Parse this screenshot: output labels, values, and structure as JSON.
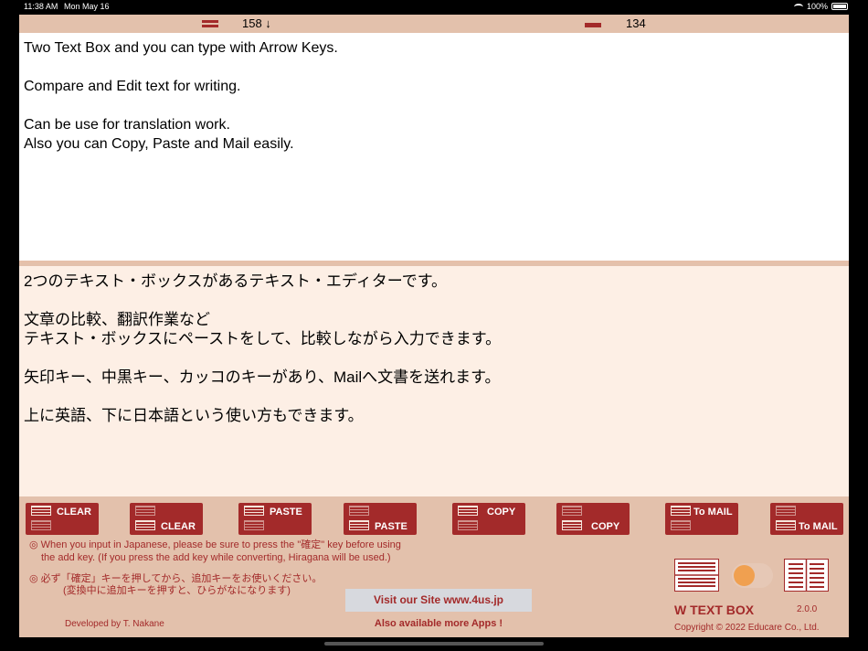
{
  "status": {
    "time": "11:38 AM",
    "date": "Mon May 16",
    "battery": "100%"
  },
  "counters": {
    "top": "158 ↓",
    "bottom": "134"
  },
  "box1_text": "Two Text Box and you can type with Arrow Keys.\n\nCompare and Edit text for writing.\n\nCan be use for translation work.\nAlso you can Copy, Paste and Mail easily.",
  "box2_text": "2つのテキスト・ボックスがあるテキスト・エディターです。\n\n文章の比較、翻訳作業など\nテキスト・ボックスにペーストをして、比較しながら入力できます。\n\n矢印キー、中黒キー、カッコのキーがあり、Mailへ文書を送れます。\n\n上に英語、下に日本語という使い方もできます。",
  "buttons": [
    {
      "label": "CLEAR",
      "target": "top"
    },
    {
      "label": "CLEAR",
      "target": "bottom"
    },
    {
      "label": "PASTE",
      "target": "top"
    },
    {
      "label": "PASTE",
      "target": "bottom"
    },
    {
      "label": "COPY",
      "target": "top"
    },
    {
      "label": "COPY",
      "target": "bottom"
    },
    {
      "label": "To MAIL",
      "target": "top"
    },
    {
      "label": "To MAIL",
      "target": "bottom"
    }
  ],
  "notes": {
    "en1": "◎ When you input in Japanese, please be sure to press the \"確定\" key before using",
    "en2": "the add key. (If you press the add key while converting, Hiragana will be used.)",
    "jp1": "◎ 必ず「確定」キーを押してから、追加キーをお使いください。",
    "jp2": "(変換中に追加キーを押すと、ひらがなになります)"
  },
  "footer": {
    "visit": "Visit our Site www.4us.jp",
    "more": "Also available more Apps !",
    "developer": "Developed by T. Nakane",
    "app_name": "W TEXT BOX",
    "version": "2.0.0",
    "copyright": "Copyright © 2022 Educare Co., Ltd."
  },
  "colors": {
    "accent": "#a32a2a",
    "background": "#e3c1ac",
    "toggle_knob": "#f0a050"
  }
}
